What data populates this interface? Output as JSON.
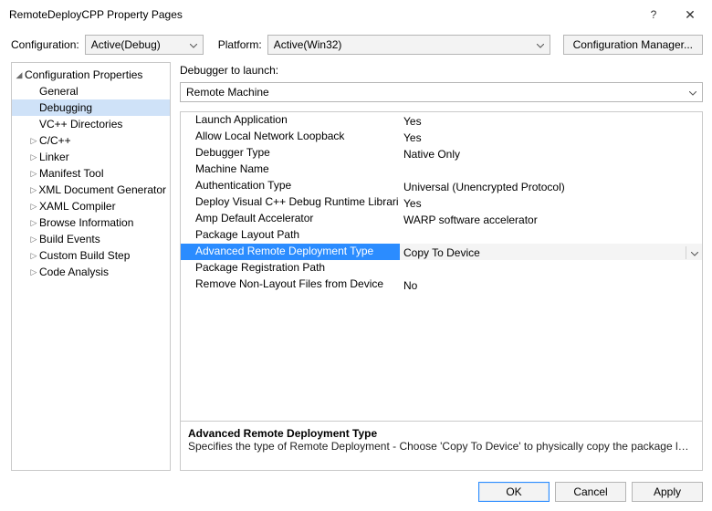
{
  "title": "RemoteDeployCPP Property Pages",
  "toprow": {
    "config_label": "Configuration:",
    "config_value": "Active(Debug)",
    "platform_label": "Platform:",
    "platform_value": "Active(Win32)",
    "manager_label": "Configuration Manager..."
  },
  "tree": {
    "root": "Configuration Properties",
    "items": [
      {
        "label": "General",
        "expander": "",
        "selected": false
      },
      {
        "label": "Debugging",
        "expander": "",
        "selected": true
      },
      {
        "label": "VC++ Directories",
        "expander": "",
        "selected": false
      },
      {
        "label": "C/C++",
        "expander": "▷",
        "selected": false
      },
      {
        "label": "Linker",
        "expander": "▷",
        "selected": false
      },
      {
        "label": "Manifest Tool",
        "expander": "▷",
        "selected": false
      },
      {
        "label": "XML Document Generator",
        "expander": "▷",
        "selected": false
      },
      {
        "label": "XAML Compiler",
        "expander": "▷",
        "selected": false
      },
      {
        "label": "Browse Information",
        "expander": "▷",
        "selected": false
      },
      {
        "label": "Build Events",
        "expander": "▷",
        "selected": false
      },
      {
        "label": "Custom Build Step",
        "expander": "▷",
        "selected": false
      },
      {
        "label": "Code Analysis",
        "expander": "▷",
        "selected": false
      }
    ]
  },
  "launcher": {
    "label": "Debugger to launch:",
    "value": "Remote Machine"
  },
  "props": [
    {
      "name": "Launch Application",
      "value": "Yes",
      "selected": false
    },
    {
      "name": "Allow Local Network Loopback",
      "value": "Yes",
      "selected": false
    },
    {
      "name": "Debugger Type",
      "value": "Native Only",
      "selected": false
    },
    {
      "name": "Machine Name",
      "value": "",
      "selected": false
    },
    {
      "name": "Authentication Type",
      "value": "Universal (Unencrypted Protocol)",
      "selected": false
    },
    {
      "name": "Deploy Visual C++ Debug Runtime Librari",
      "value": "Yes",
      "selected": false
    },
    {
      "name": "Amp Default Accelerator",
      "value": "WARP software accelerator",
      "selected": false
    },
    {
      "name": "Package Layout Path",
      "value": "",
      "selected": false
    },
    {
      "name": "Advanced Remote Deployment Type",
      "value": "Copy To Device",
      "selected": true
    },
    {
      "name": "Package Registration Path",
      "value": "",
      "selected": false
    },
    {
      "name": "Remove Non-Layout Files from Device",
      "value": "No",
      "selected": false
    }
  ],
  "desc": {
    "title": "Advanced Remote Deployment Type",
    "body": "Specifies the type of Remote Deployment - Choose 'Copy To Device' to physically copy the package layout to re..."
  },
  "footer": {
    "ok": "OK",
    "cancel": "Cancel",
    "apply": "Apply"
  }
}
